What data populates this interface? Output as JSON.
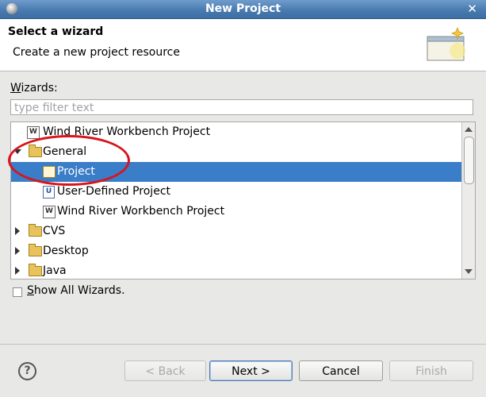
{
  "window": {
    "title": "New Project"
  },
  "header": {
    "title": "Select a wizard",
    "subtitle": "Create a new project resource"
  },
  "wizards_label": "Wizards:",
  "filter": {
    "placeholder": "type filter text",
    "value": ""
  },
  "tree": {
    "items": [
      {
        "label": "Wind River Workbench Project",
        "icon": "wind-river-icon",
        "level": 0,
        "expanded": null,
        "selected": false
      },
      {
        "label": "General",
        "icon": "folder-icon",
        "level": 0,
        "expanded": true,
        "selected": false
      },
      {
        "label": "Project",
        "icon": "project-icon",
        "level": 1,
        "expanded": null,
        "selected": true
      },
      {
        "label": "User-Defined Project",
        "icon": "user-defined-project-icon",
        "level": 1,
        "expanded": null,
        "selected": false
      },
      {
        "label": "Wind River Workbench Project",
        "icon": "wind-river-icon",
        "level": 1,
        "expanded": null,
        "selected": false
      },
      {
        "label": "CVS",
        "icon": "folder-icon",
        "level": 0,
        "expanded": false,
        "selected": false
      },
      {
        "label": "Desktop",
        "icon": "folder-icon",
        "level": 0,
        "expanded": false,
        "selected": false
      },
      {
        "label": "Java",
        "icon": "folder-icon",
        "level": 0,
        "expanded": false,
        "selected": false
      }
    ]
  },
  "show_all": {
    "label": "Show All Wizards.",
    "checked": false
  },
  "buttons": {
    "back": "< Back",
    "next": "Next >",
    "cancel": "Cancel",
    "finish": "Finish"
  },
  "colors": {
    "selection": "#3a7dc8",
    "highlight_circle": "#d8141c",
    "titlebar": "#4a7bb0"
  }
}
